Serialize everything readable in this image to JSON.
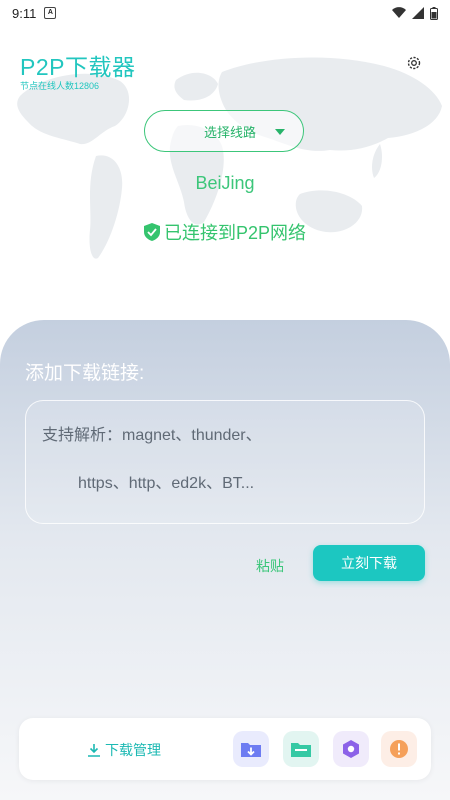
{
  "status_bar": {
    "time": "9:11",
    "notification_glyph": "A"
  },
  "header": {
    "title": "P2P下载器",
    "node_count_text": "节点在线人数12806"
  },
  "route": {
    "select_label": "选择线路",
    "city": "BeiJing",
    "connection_status": "已连接到P2P网络"
  },
  "panel": {
    "heading": "添加下载链接:",
    "input_line1": "支持解析：magnet、thunder、",
    "input_line2": "https、http、ed2k、BT...",
    "paste_label": "粘贴",
    "download_now_label": "立刻下载"
  },
  "bottom_bar": {
    "download_manager_label": "下载管理"
  },
  "colors": {
    "teal": "#1cc7c1",
    "green": "#3cc67a",
    "panel_top": "#c4cfdf"
  }
}
